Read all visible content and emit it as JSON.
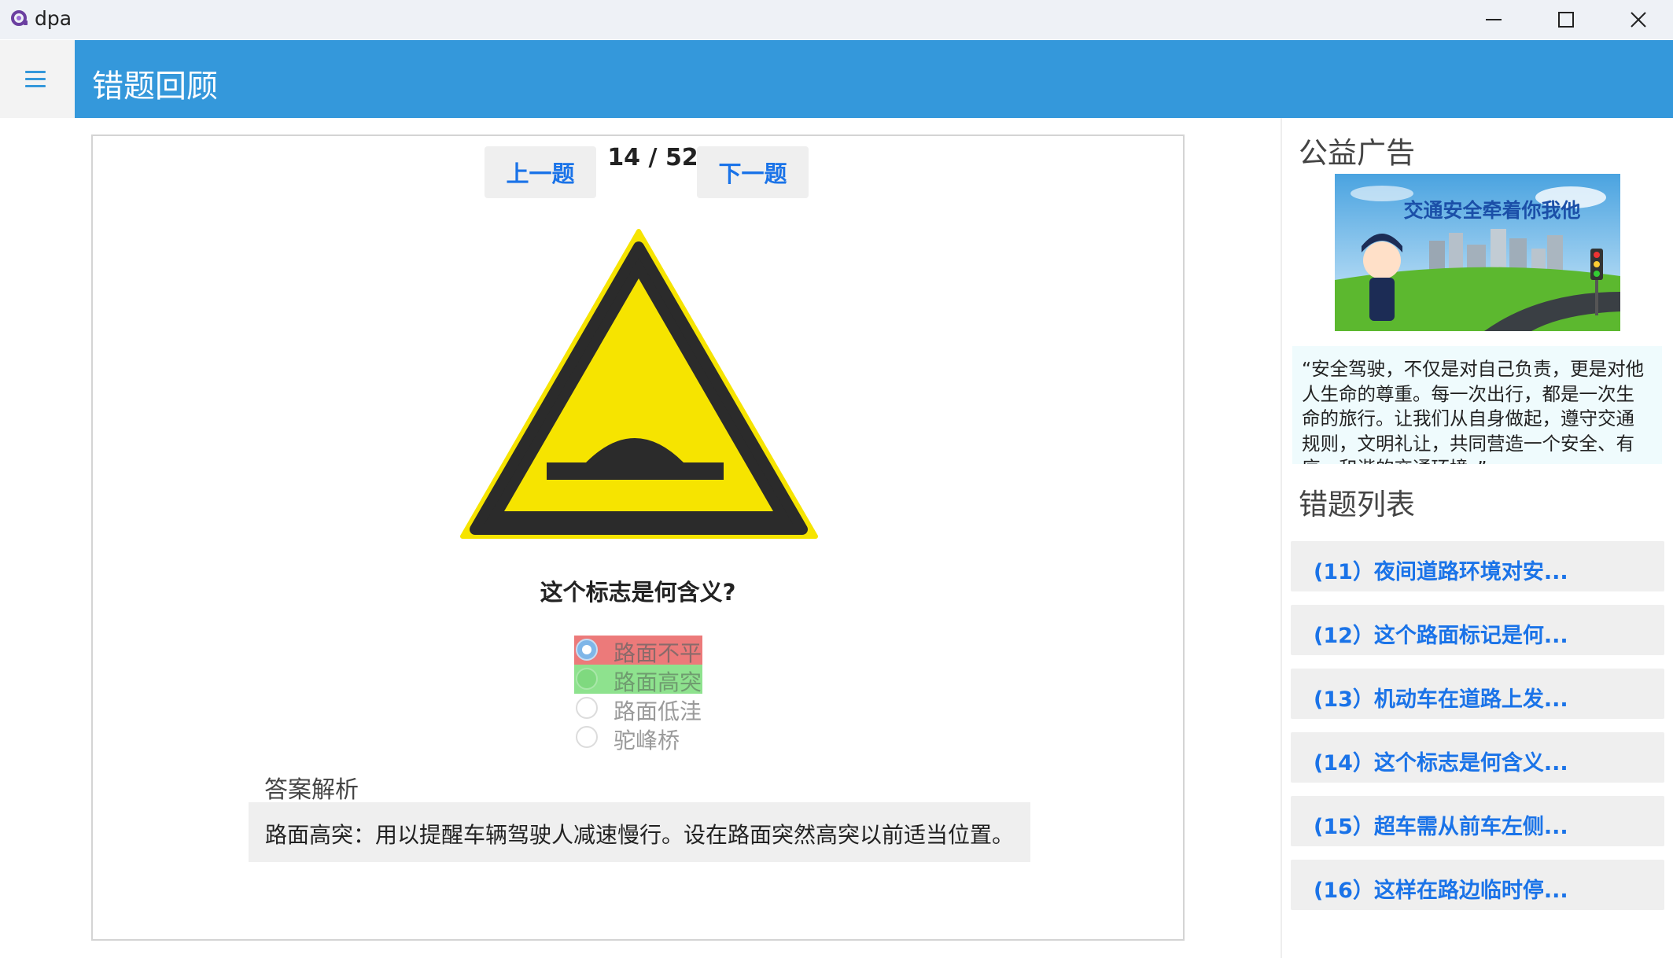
{
  "window": {
    "app_name": "dpa",
    "minimize_icon": "minimize-icon",
    "maximize_icon": "maximize-icon",
    "close_icon": "close-icon"
  },
  "header": {
    "menu_icon": "hamburger-menu-icon",
    "title": "错题回顾",
    "accent_color": "#3498db"
  },
  "quiz": {
    "prev_label": "上一题",
    "next_label": "下一题",
    "current": "14",
    "separator": "/",
    "total": "52",
    "question": "这个标志是何含义?",
    "sign_icon": "speed-bump-warning-sign-icon",
    "options": [
      {
        "label": "路面不平",
        "state": "selected-wrong"
      },
      {
        "label": "路面高突",
        "state": "correct"
      },
      {
        "label": "路面低洼",
        "state": "none"
      },
      {
        "label": "驼峰桥",
        "state": "none"
      }
    ],
    "analysis_title": "答案解析",
    "analysis_text": "路面高突：用以提醒车辆驾驶人减速慢行。设在路面突然高突以前适当位置。",
    "wrong_color": "#ec7a7a",
    "correct_color": "#8ee28e"
  },
  "sidebar": {
    "ad_title": "公益广告",
    "ad_banner_text": "交通安全牵着你我他",
    "ad_quote": "“安全驾驶，不仅是对自己负责，更是对他人生命的尊重。每一次出行，都是一次生命的旅行。让我们从自身做起，遵守交通规则，文明礼让，共同营造一个安全、有序、和谐的交通环境。”",
    "list_title": "错题列表",
    "wrong_items": [
      "(11）夜间道路环境对安...",
      "(12）这个路面标记是何...",
      "(13）机动车在道路上发...",
      "(14）这个标志是何含义...",
      "(15）超车需从前车左侧...",
      "(16）这样在路边临时停..."
    ]
  }
}
